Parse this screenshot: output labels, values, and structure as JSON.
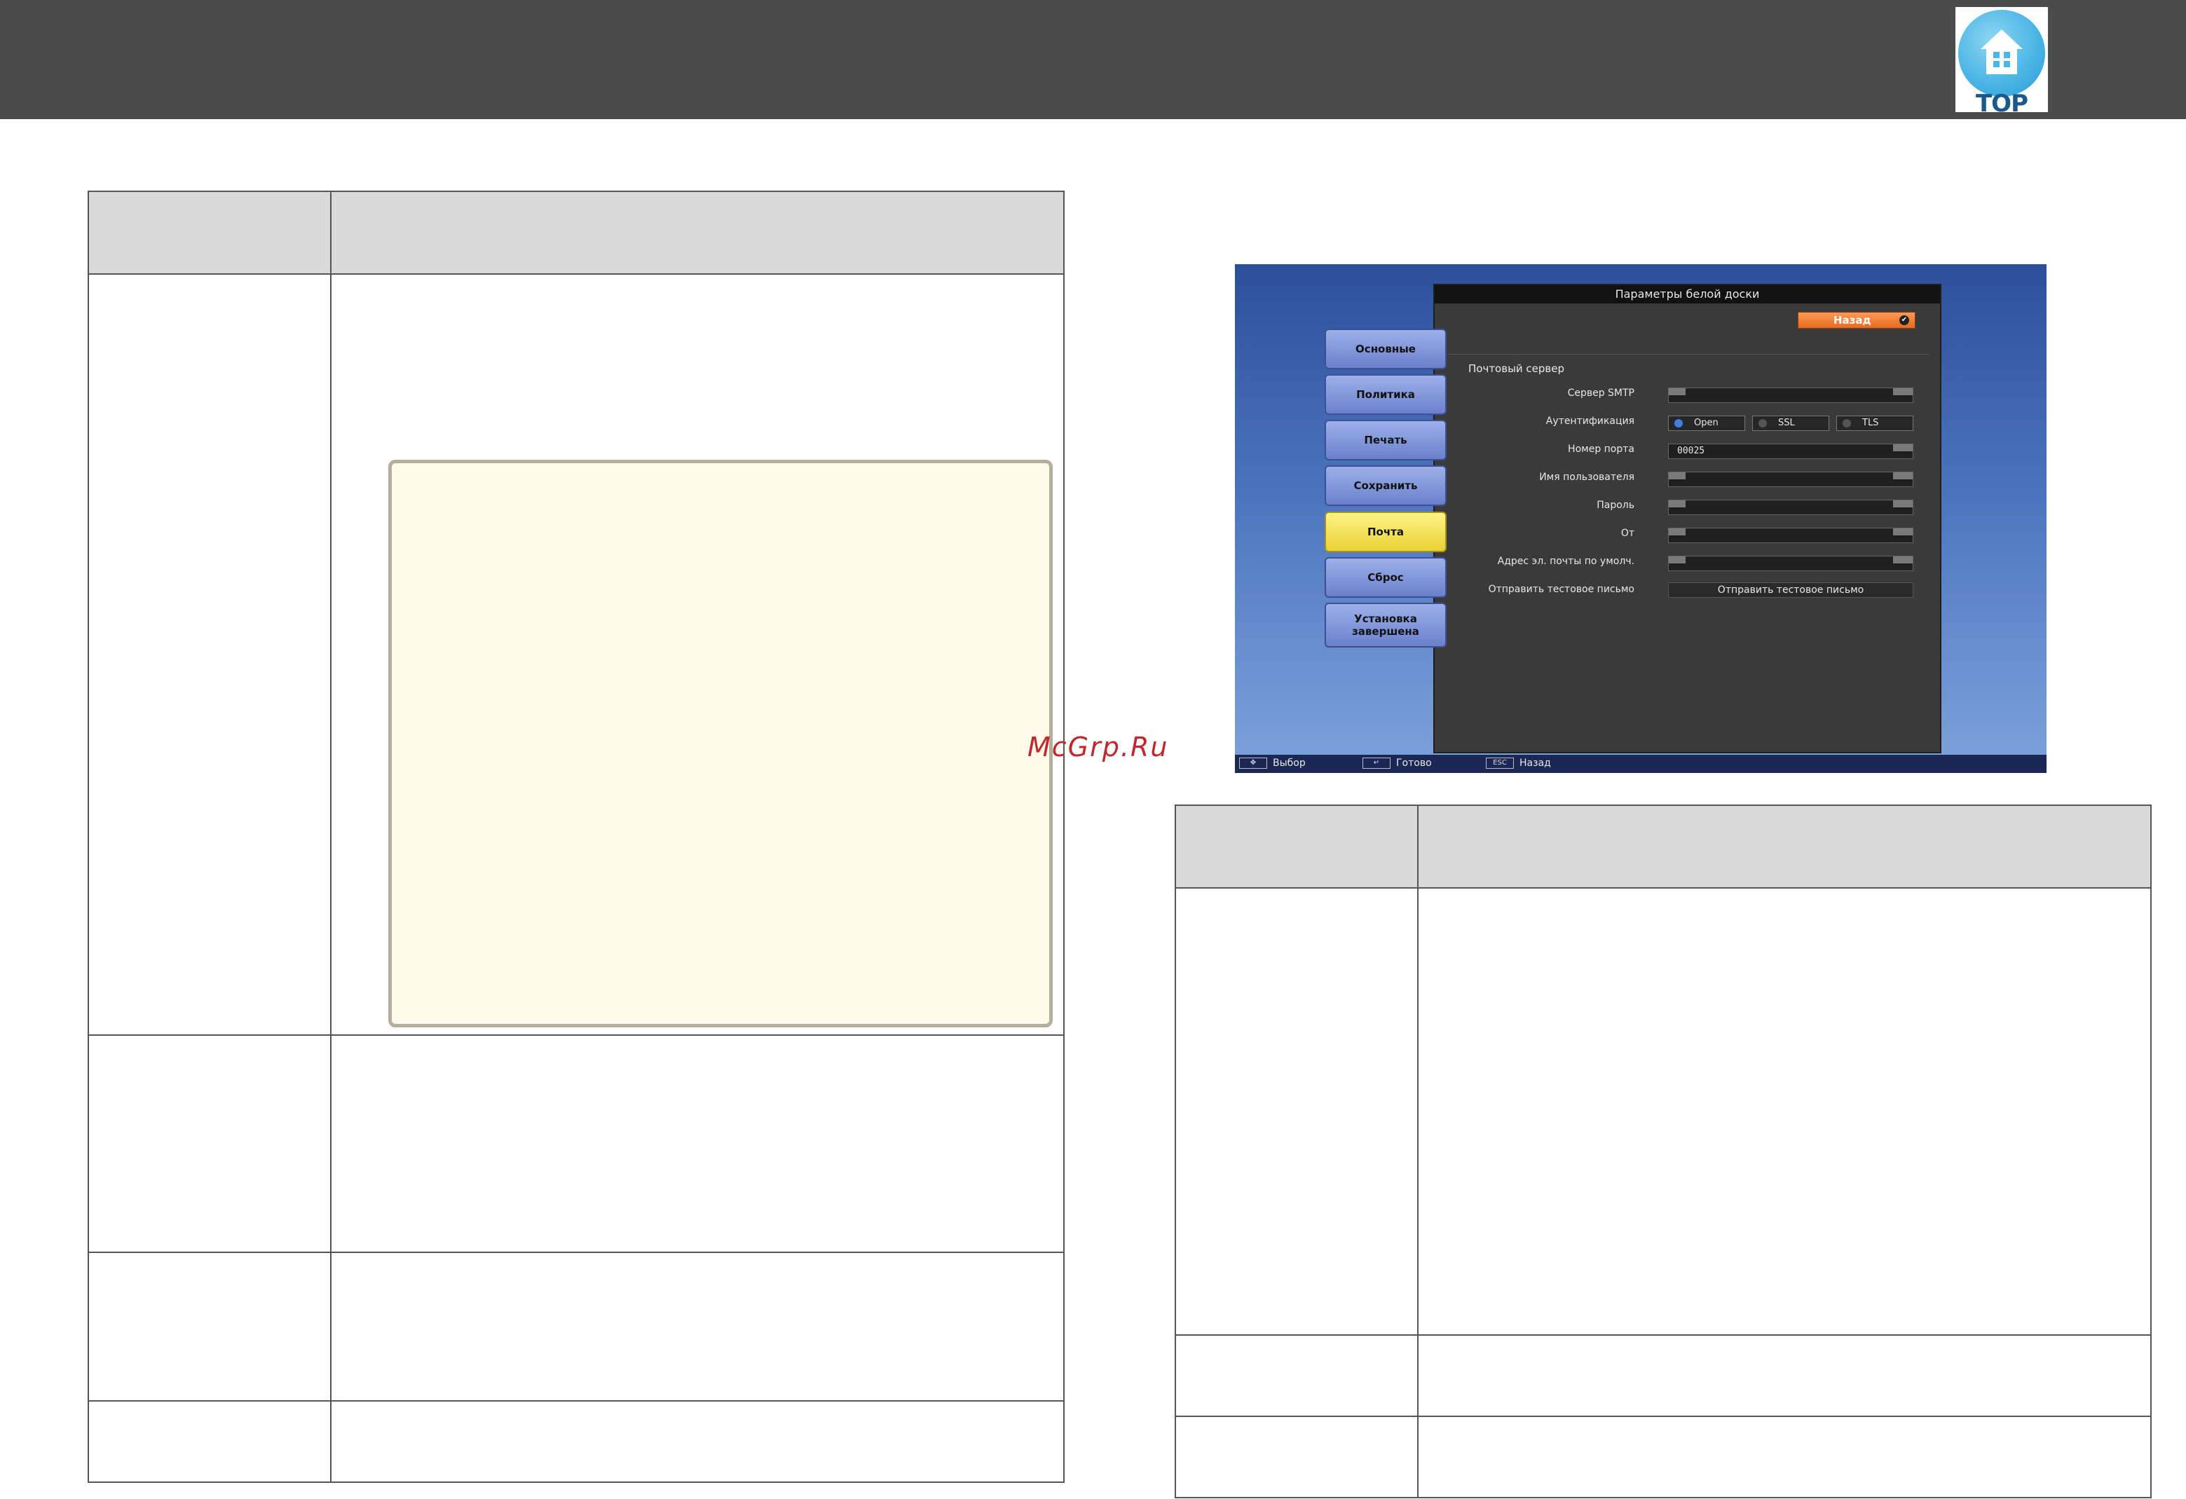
{
  "header": {
    "top_badge_label": "TOP",
    "top_badge_icon": "house-icon"
  },
  "watermark": "McGrp.Ru",
  "screenshot": {
    "panel_title": "Параметры белой доски",
    "back_button": "Назад",
    "section_title": "Почтовый сервер",
    "tabs": [
      {
        "label": "Основные"
      },
      {
        "label": "Политика"
      },
      {
        "label": "Печать"
      },
      {
        "label": "Сохранить"
      },
      {
        "label": "Почта",
        "active": true
      },
      {
        "label": "Сброс"
      },
      {
        "label": "Установка завершена"
      }
    ],
    "fields": {
      "smtp_label": "Сервер SMTP",
      "smtp_value": "",
      "auth_label": "Аутентификация",
      "auth_options": [
        "Open",
        "SSL",
        "TLS"
      ],
      "port_label": "Номер порта",
      "port_value": "00025",
      "user_label": "Имя пользователя",
      "user_value": "",
      "password_label": "Пароль",
      "password_value": "",
      "from_label": "От",
      "from_value": "",
      "default_email_label": "Адрес эл. почты по умолч.",
      "default_email_value": "",
      "test_label": "Отправить тестовое письмо",
      "test_button": "Отправить тестовое письмо"
    },
    "footer": {
      "select_hint": "Выбор",
      "done_hint": "Готово",
      "back_hint": "Назад",
      "esc_key": "ESC"
    }
  }
}
